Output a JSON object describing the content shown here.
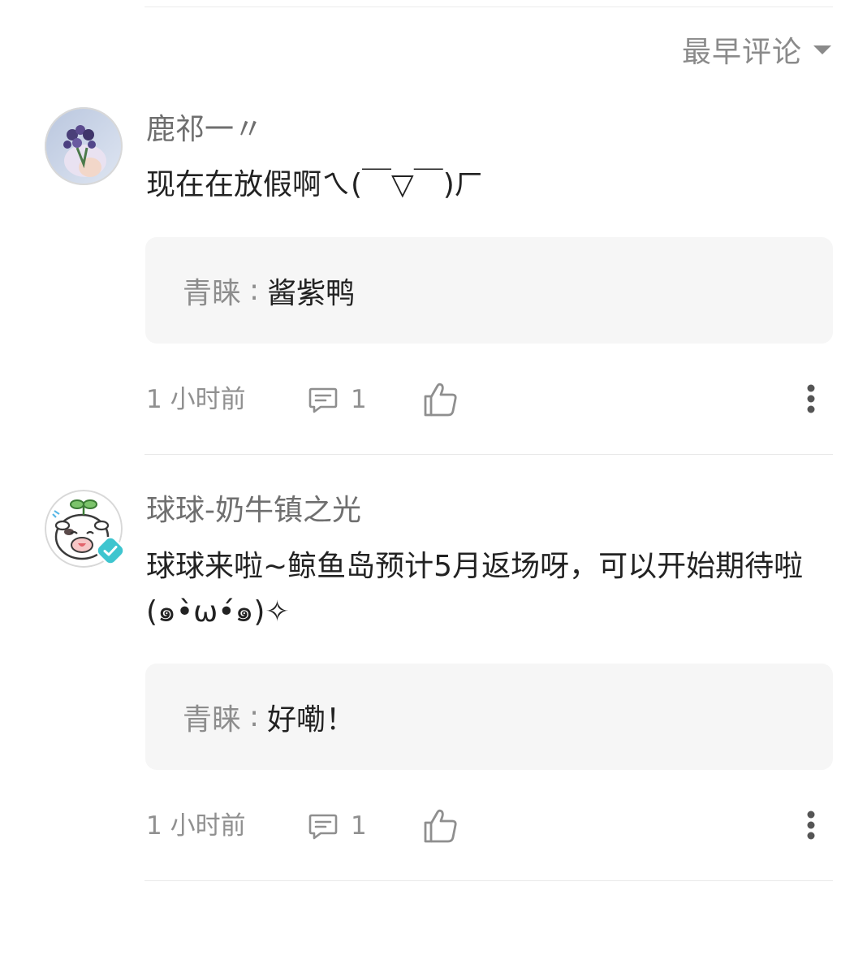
{
  "sort": {
    "label": "最早评论"
  },
  "comments": [
    {
      "username": "鹿祁一〃",
      "text": "现在在放假啊ㄟ(￣▽￣)ㄏ",
      "reply": {
        "author": "青睐",
        "separator": ":",
        "content": "酱紫鸭"
      },
      "time": "1 小时前",
      "reply_count": "1",
      "verified": false
    },
    {
      "username": "球球-奶牛镇之光",
      "text": "球球来啦~鲸鱼岛预计5月返场呀，可以开始期待啦(๑•̀ω•́๑)✧",
      "reply": {
        "author": "青睐",
        "separator": ":",
        "content": "好嘞！"
      },
      "time": "1 小时前",
      "reply_count": "1",
      "verified": true
    }
  ],
  "colors": {
    "verified_badge": "#3ec5cf",
    "reply_background": "#f6f6f6",
    "meta_text": "#909090"
  },
  "icons": {
    "sort": "caret-down-icon",
    "reply": "comment-bubble-icon",
    "like": "thumbs-up-icon",
    "more": "more-vertical-icon",
    "verified": "verified-badge-icon"
  }
}
